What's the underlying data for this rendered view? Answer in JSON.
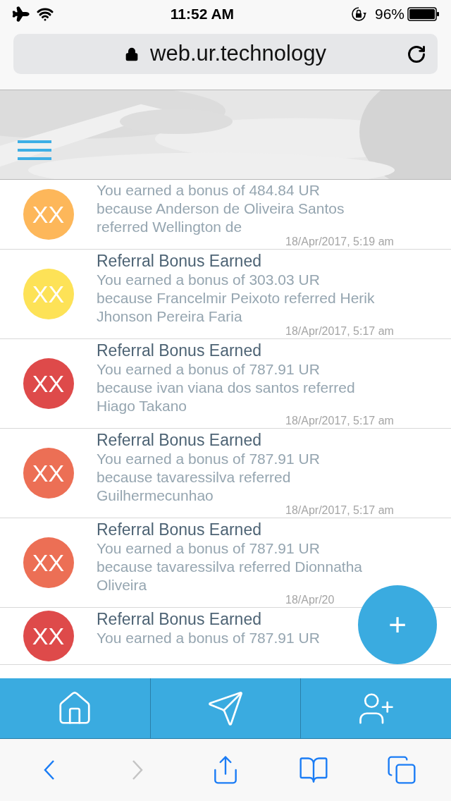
{
  "status_bar": {
    "time": "11:52 AM",
    "battery": "96%"
  },
  "address_bar": {
    "url": "web.ur.technology"
  },
  "notifications": [
    {
      "avatar": "XX",
      "color": "#fdb75a",
      "body": "You earned a bonus of 484.84 UR because Anderson de Oliveira Santos referred Wellington de",
      "date": "18/Apr/2017, 5:19 am"
    },
    {
      "avatar": "XX",
      "color": "#fde257",
      "title": "Referral Bonus Earned",
      "body": "You earned a bonus of 303.03 UR because Francelmir Peixoto referred Herik Jhonson Pereira Faria",
      "date": "18/Apr/2017, 5:17 am"
    },
    {
      "avatar": "XX",
      "color": "#de4a4a",
      "title": "Referral Bonus Earned",
      "body": "You earned a bonus of 787.91 UR because ivan viana dos santos referred Hiago Takano",
      "date": "18/Apr/2017, 5:17 am"
    },
    {
      "avatar": "XX",
      "color": "#ec6f55",
      "title": "Referral Bonus Earned",
      "body": "You earned a bonus of 787.91 UR because tavaressilva referred Guilhermecunhao",
      "date": "18/Apr/2017, 5:17 am"
    },
    {
      "avatar": "XX",
      "color": "#ec6f55",
      "title": "Referral Bonus Earned",
      "body": "You earned a bonus of 787.91 UR because tavaressilva referred Dionnatha Oliveira",
      "date": "18/Apr/20"
    },
    {
      "avatar": "XX",
      "color": "#de4a4a",
      "title": "Referral Bonus Earned",
      "body": "You earned a bonus of 787.91 UR"
    }
  ],
  "fab": {
    "label": "+"
  },
  "tab_bar": [
    {
      "kind": "home"
    },
    {
      "kind": "send"
    },
    {
      "kind": "invite"
    }
  ],
  "browser_toolbar": [
    {
      "kind": "back",
      "disabled": false
    },
    {
      "kind": "forward",
      "disabled": true
    },
    {
      "kind": "share",
      "disabled": false
    },
    {
      "kind": "bookmarks",
      "disabled": false
    },
    {
      "kind": "tabs",
      "disabled": false
    }
  ]
}
